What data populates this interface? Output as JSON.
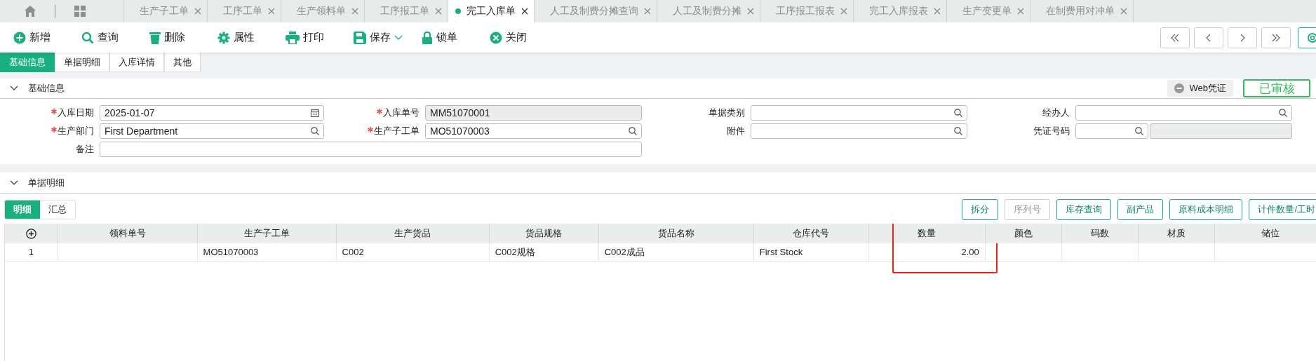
{
  "tabs": [
    {
      "label": "生产子工单",
      "selected": false
    },
    {
      "label": "工序工单",
      "selected": false
    },
    {
      "label": "生产领料单",
      "selected": false
    },
    {
      "label": "工序报工单",
      "selected": false
    },
    {
      "label": "完工入库单",
      "selected": true
    },
    {
      "label": "人工及制费分摊查询",
      "selected": false
    },
    {
      "label": "人工及制费分摊",
      "selected": false
    },
    {
      "label": "工序报工报表",
      "selected": false
    },
    {
      "label": "完工入库报表",
      "selected": false
    },
    {
      "label": "生产变更单",
      "selected": false
    },
    {
      "label": "在制费用对冲单",
      "selected": false
    }
  ],
  "toolbar": [
    {
      "label": "新增",
      "kind": "add",
      "dropdown": false
    },
    {
      "label": "查询",
      "kind": "search",
      "dropdown": false
    },
    {
      "label": "删除",
      "kind": "delete",
      "dropdown": false
    },
    {
      "label": "属性",
      "kind": "settings",
      "dropdown": false
    },
    {
      "label": "打印",
      "kind": "print",
      "dropdown": false
    },
    {
      "label": "保存",
      "kind": "save",
      "dropdown": true
    },
    {
      "label": "锁单",
      "kind": "lock",
      "dropdown": false
    },
    {
      "label": "关闭",
      "kind": "close",
      "dropdown": false
    }
  ],
  "form_tabs": [
    {
      "label": "基础信息",
      "selected": true
    },
    {
      "label": "单据明细",
      "selected": false
    },
    {
      "label": "入库详情",
      "selected": false
    },
    {
      "label": "其他",
      "selected": false
    }
  ],
  "basic_section": {
    "title": "基础信息",
    "expanded": true,
    "voucher_button": "Web凭证",
    "status": "已审核"
  },
  "fields": [
    {
      "label": "入库日期",
      "required": true,
      "kind": "date",
      "value": "2025-01-07"
    },
    {
      "label": "入库单号",
      "required": true,
      "kind": "readonly",
      "value": "MM51070001"
    },
    {
      "label": "单据类别",
      "required": false,
      "kind": "lookup"
    },
    {
      "label": "经办人",
      "required": false,
      "kind": "lookup"
    },
    {
      "label": "生产部门",
      "required": true,
      "kind": "lookup",
      "value": "First Department"
    },
    {
      "label": "生产子工单",
      "required": true,
      "kind": "lookup",
      "value": "MO51070003"
    },
    {
      "label": "附件",
      "required": false,
      "kind": "lookup"
    },
    {
      "label": "凭证号码",
      "required": false,
      "kind": "lookup_pair"
    },
    {
      "label": "备注",
      "required": false,
      "kind": "wide"
    }
  ],
  "detail_section": {
    "title": "单据明细",
    "expanded": true
  },
  "detail_tabs": [
    {
      "label": "明细",
      "selected": true
    },
    {
      "label": "汇总",
      "selected": false
    }
  ],
  "action_buttons": [
    {
      "label": "拆分",
      "disabled": false
    },
    {
      "label": "序列号",
      "disabled": true
    },
    {
      "label": "库存查询",
      "disabled": false
    },
    {
      "label": "副产品",
      "disabled": false
    },
    {
      "label": "原料成本明细",
      "disabled": false
    },
    {
      "label": "计件数量/工时",
      "disabled": false
    }
  ],
  "table": {
    "columns": [
      {
        "label": "领料单号",
        "kind": "text",
        "highlighted": false
      },
      {
        "label": "生产子工单",
        "kind": "text",
        "highlighted": false
      },
      {
        "label": "生产货品",
        "kind": "text",
        "highlighted": false
      },
      {
        "label": "货品规格",
        "kind": "text",
        "highlighted": false
      },
      {
        "label": "货品名称",
        "kind": "text",
        "highlighted": false
      },
      {
        "label": "仓库代号",
        "kind": "text",
        "highlighted": false
      },
      {
        "label": "数量",
        "kind": "number",
        "highlighted": true
      },
      {
        "label": "颜色",
        "kind": "text",
        "highlighted": false
      },
      {
        "label": "码数",
        "kind": "text",
        "highlighted": false
      },
      {
        "label": "材质",
        "kind": "text",
        "highlighted": false
      },
      {
        "label": "储位",
        "kind": "text",
        "highlighted": false
      }
    ],
    "rows": [
      {
        "index": "1",
        "cells": [
          null,
          "MO51070003",
          "C002",
          "C002规格",
          "C002成品",
          "First Stock",
          "2.00",
          null,
          null,
          null,
          null
        ]
      }
    ]
  }
}
